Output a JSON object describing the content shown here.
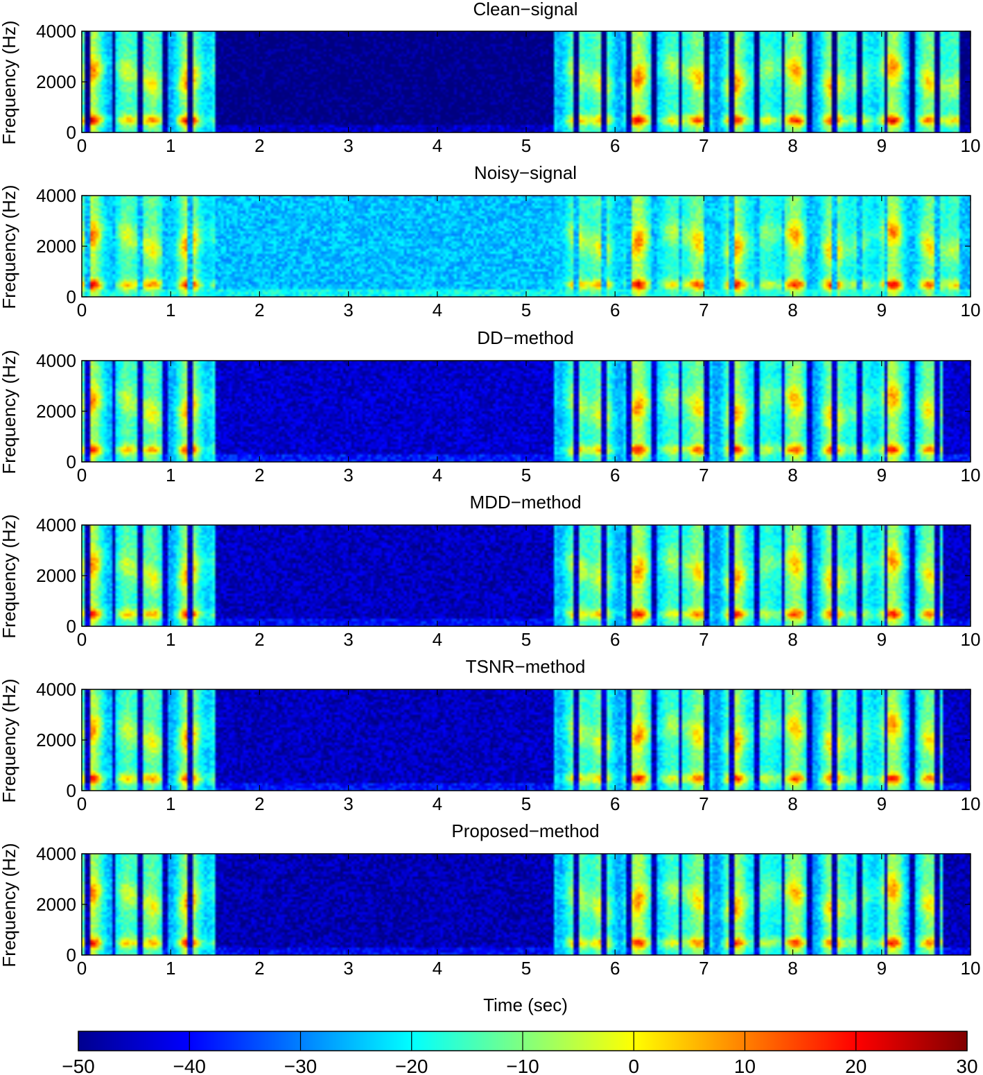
{
  "chart_data": [
    {
      "type": "heatmap",
      "title": "Clean−signal",
      "xlabel": "",
      "ylabel": "Frequency (Hz)",
      "xlim": [
        0,
        10
      ],
      "ylim": [
        0,
        4000
      ],
      "x_ticks": [
        "0",
        "1",
        "2",
        "3",
        "4",
        "5",
        "6",
        "7",
        "8",
        "9",
        "10"
      ],
      "y_ticks": [
        "0",
        "2000",
        "4000"
      ],
      "noise_floor_db": -50,
      "speech_regions_sec": [
        [
          0.0,
          1.55
        ],
        [
          5.3,
          9.95
        ]
      ],
      "low_band_peak_db": 15
    },
    {
      "type": "heatmap",
      "title": "Noisy−signal",
      "xlabel": "",
      "ylabel": "Frequency (Hz)",
      "xlim": [
        0,
        10
      ],
      "ylim": [
        0,
        4000
      ],
      "x_ticks": [
        "0",
        "1",
        "2",
        "3",
        "4",
        "5",
        "6",
        "7",
        "8",
        "9",
        "10"
      ],
      "y_ticks": [
        "0",
        "2000",
        "4000"
      ],
      "noise_floor_db": -25,
      "speech_regions_sec": [
        [
          0.0,
          1.55
        ],
        [
          5.3,
          9.95
        ]
      ],
      "low_band_peak_db": 15
    },
    {
      "type": "heatmap",
      "title": "DD−method",
      "xlabel": "",
      "ylabel": "Frequency (Hz)",
      "xlim": [
        0,
        10
      ],
      "ylim": [
        0,
        4000
      ],
      "x_ticks": [
        "0",
        "1",
        "2",
        "3",
        "4",
        "5",
        "6",
        "7",
        "8",
        "9",
        "10"
      ],
      "y_ticks": [
        "0",
        "2000",
        "4000"
      ],
      "noise_floor_db": -44,
      "speech_regions_sec": [
        [
          0.0,
          1.55
        ],
        [
          5.3,
          9.7
        ]
      ],
      "low_band_peak_db": 12
    },
    {
      "type": "heatmap",
      "title": "MDD−method",
      "xlabel": "",
      "ylabel": "Frequency (Hz)",
      "xlim": [
        0,
        10
      ],
      "ylim": [
        0,
        4000
      ],
      "x_ticks": [
        "0",
        "1",
        "2",
        "3",
        "4",
        "5",
        "6",
        "7",
        "8",
        "9",
        "10"
      ],
      "y_ticks": [
        "0",
        "2000",
        "4000"
      ],
      "noise_floor_db": -45,
      "speech_regions_sec": [
        [
          0.0,
          1.55
        ],
        [
          5.3,
          9.7
        ]
      ],
      "low_band_peak_db": 12
    },
    {
      "type": "heatmap",
      "title": "TSNR−method",
      "xlabel": "",
      "ylabel": "Frequency (Hz)",
      "xlim": [
        0,
        10
      ],
      "ylim": [
        0,
        4000
      ],
      "x_ticks": [
        "0",
        "1",
        "2",
        "3",
        "4",
        "5",
        "6",
        "7",
        "8",
        "9",
        "10"
      ],
      "y_ticks": [
        "0",
        "2000",
        "4000"
      ],
      "noise_floor_db": -45,
      "speech_regions_sec": [
        [
          0.0,
          1.55
        ],
        [
          5.3,
          9.7
        ]
      ],
      "low_band_peak_db": 12
    },
    {
      "type": "heatmap",
      "title": "Proposed−method",
      "xlabel": "Time (sec)",
      "ylabel": "Frequency (Hz)",
      "xlim": [
        0,
        10
      ],
      "ylim": [
        0,
        4000
      ],
      "x_ticks": [
        "0",
        "1",
        "2",
        "3",
        "4",
        "5",
        "6",
        "7",
        "8",
        "9",
        "10"
      ],
      "y_ticks": [
        "0",
        "2000",
        "4000"
      ],
      "noise_floor_db": -46,
      "speech_regions_sec": [
        [
          0.0,
          1.55
        ],
        [
          5.3,
          9.7
        ]
      ],
      "low_band_peak_db": 12
    }
  ],
  "colorbar": {
    "colormap": "jet",
    "range_db": [
      -50,
      30
    ],
    "ticks": [
      "−50",
      "−40",
      "−30",
      "−20",
      "−10",
      "0",
      "10",
      "20",
      "30"
    ]
  }
}
